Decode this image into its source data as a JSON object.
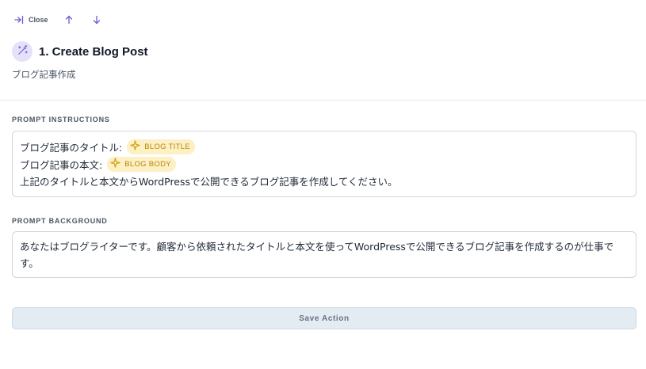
{
  "toolbar": {
    "close_label": "Close",
    "icons": {
      "close": "arrow-right-to-line-icon",
      "up": "arrow-up-icon",
      "down": "arrow-down-icon"
    }
  },
  "header": {
    "icon": "magic-wand-icon",
    "title": "1. Create Blog Post",
    "subtitle": "ブログ記事作成"
  },
  "prompt_instructions": {
    "label": "PROMPT INSTRUCTIONS",
    "lines": [
      {
        "text": "ブログ記事のタイトル:",
        "chip": "BLOG TITLE"
      },
      {
        "text": "ブログ記事の本文:",
        "chip": "BLOG BODY"
      },
      {
        "text": "上記のタイトルと本文からWordPressで公開できるブログ記事を作成してください。"
      }
    ]
  },
  "prompt_background": {
    "label": "PROMPT BACKGROUND",
    "text": "あなたはブログライターです。顧客から依頼されたタイトルと本文を使ってWordPressで公開できるブログ記事を作成するのが仕事です。"
  },
  "save_label": "Save Action",
  "colors": {
    "accent": "#6d5bd0",
    "chip_bg": "#fdf0c4",
    "chip_text": "#b8860b",
    "button_bg": "#e3ebf3"
  }
}
